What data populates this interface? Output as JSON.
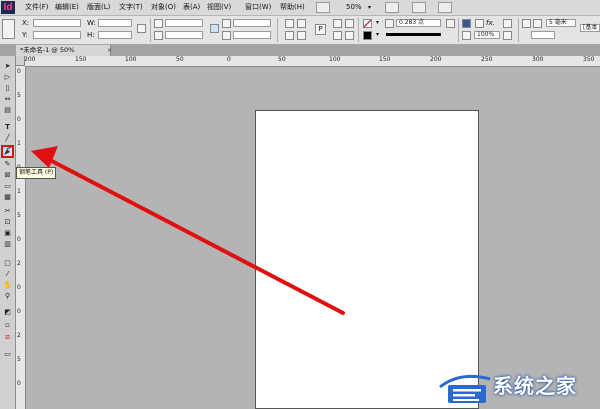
{
  "app": {
    "logo": "Id"
  },
  "menu": [
    "文件(F)",
    "编辑(E)",
    "版面(L)",
    "文字(T)",
    "对象(O)",
    "表(A)",
    "视图(V)",
    "窗口(W)",
    "帮助(H)"
  ],
  "menubar_right": {
    "zoom": "50%"
  },
  "control": {
    "x_label": "X:",
    "y_label": "Y:",
    "w_label": "W:",
    "h_label": "H:",
    "stroke_weight": "0.283 点",
    "opacity": "100%",
    "spacing": "5 毫米",
    "style_box": "[基本"
  },
  "document_tab": {
    "title": "*未命名-1 @ 50%",
    "close": "×"
  },
  "ruler": {
    "h_labels": [
      "200",
      "150",
      "100",
      "50",
      "0",
      "50",
      "100",
      "150",
      "200",
      "250",
      "300",
      "350",
      "400"
    ],
    "v_labels": [
      "0",
      "5",
      "0",
      "1",
      "0",
      "1",
      "5",
      "0",
      "2",
      "0",
      "0",
      "2",
      "5",
      "0"
    ]
  },
  "tooltip": {
    "text": "钢笔工具 (P)"
  },
  "watermark": {
    "text": "系统之家"
  },
  "colors": {
    "highlight": "#e01010",
    "arrow": "#e01010",
    "page": "#ffffff",
    "pasteboard": "#b4b4b4",
    "logo_bg": "#1e2a52",
    "logo_fg": "#ff3b8d"
  }
}
